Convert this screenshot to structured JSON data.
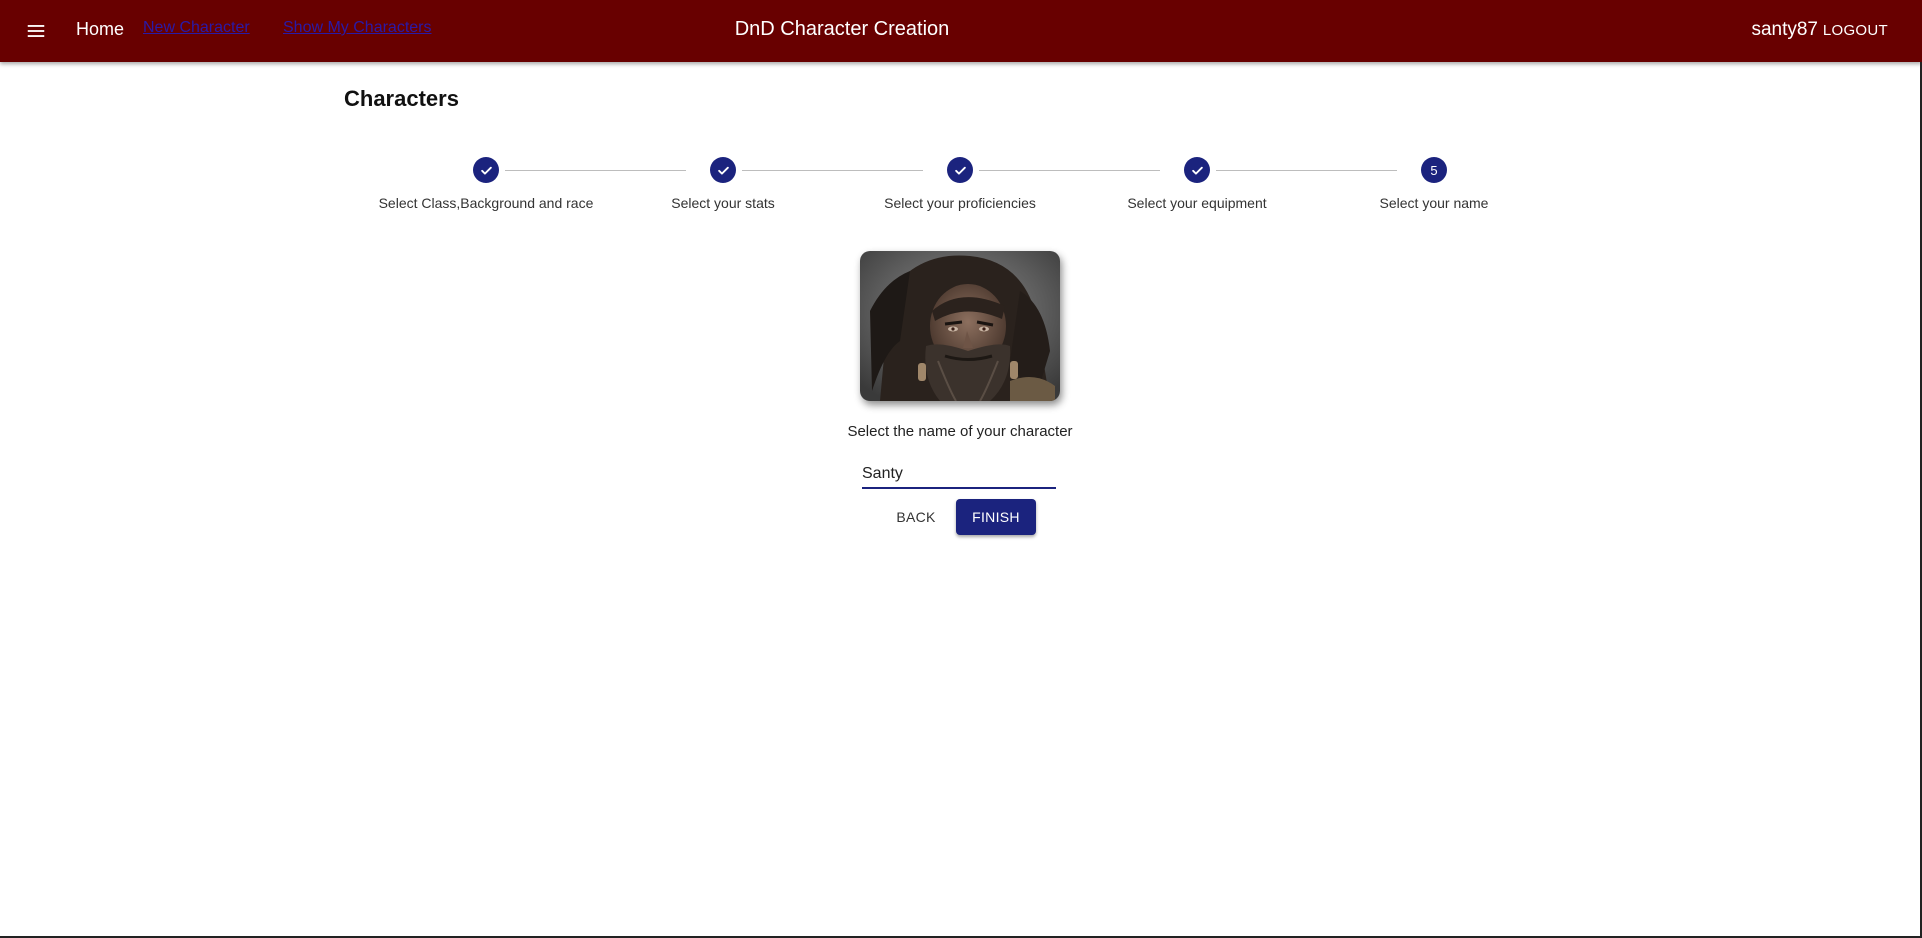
{
  "appbar": {
    "home_label": "Home",
    "new_character_label": "New Character",
    "show_characters_label": "Show My Characters",
    "title": "DnD Character Creation",
    "username": "santy87",
    "logout_label": "LOGOUT",
    "background_color": "#680000"
  },
  "page": {
    "heading": "Characters"
  },
  "stepper": {
    "accent_color": "#1b237e",
    "steps": [
      {
        "label": "Select Class,Background and race",
        "state": "completed",
        "icon": "check-icon"
      },
      {
        "label": "Select your stats",
        "state": "completed",
        "icon": "check-icon"
      },
      {
        "label": "Select your proficiencies",
        "state": "completed",
        "icon": "check-icon"
      },
      {
        "label": "Select your equipment",
        "state": "completed",
        "icon": "check-icon"
      },
      {
        "label": "Select your name",
        "state": "active",
        "number": "5"
      }
    ]
  },
  "name_form": {
    "prompt": "Select the name of your character",
    "name_value": "Santy",
    "back_label": "BACK",
    "finish_label": "FINISH"
  }
}
